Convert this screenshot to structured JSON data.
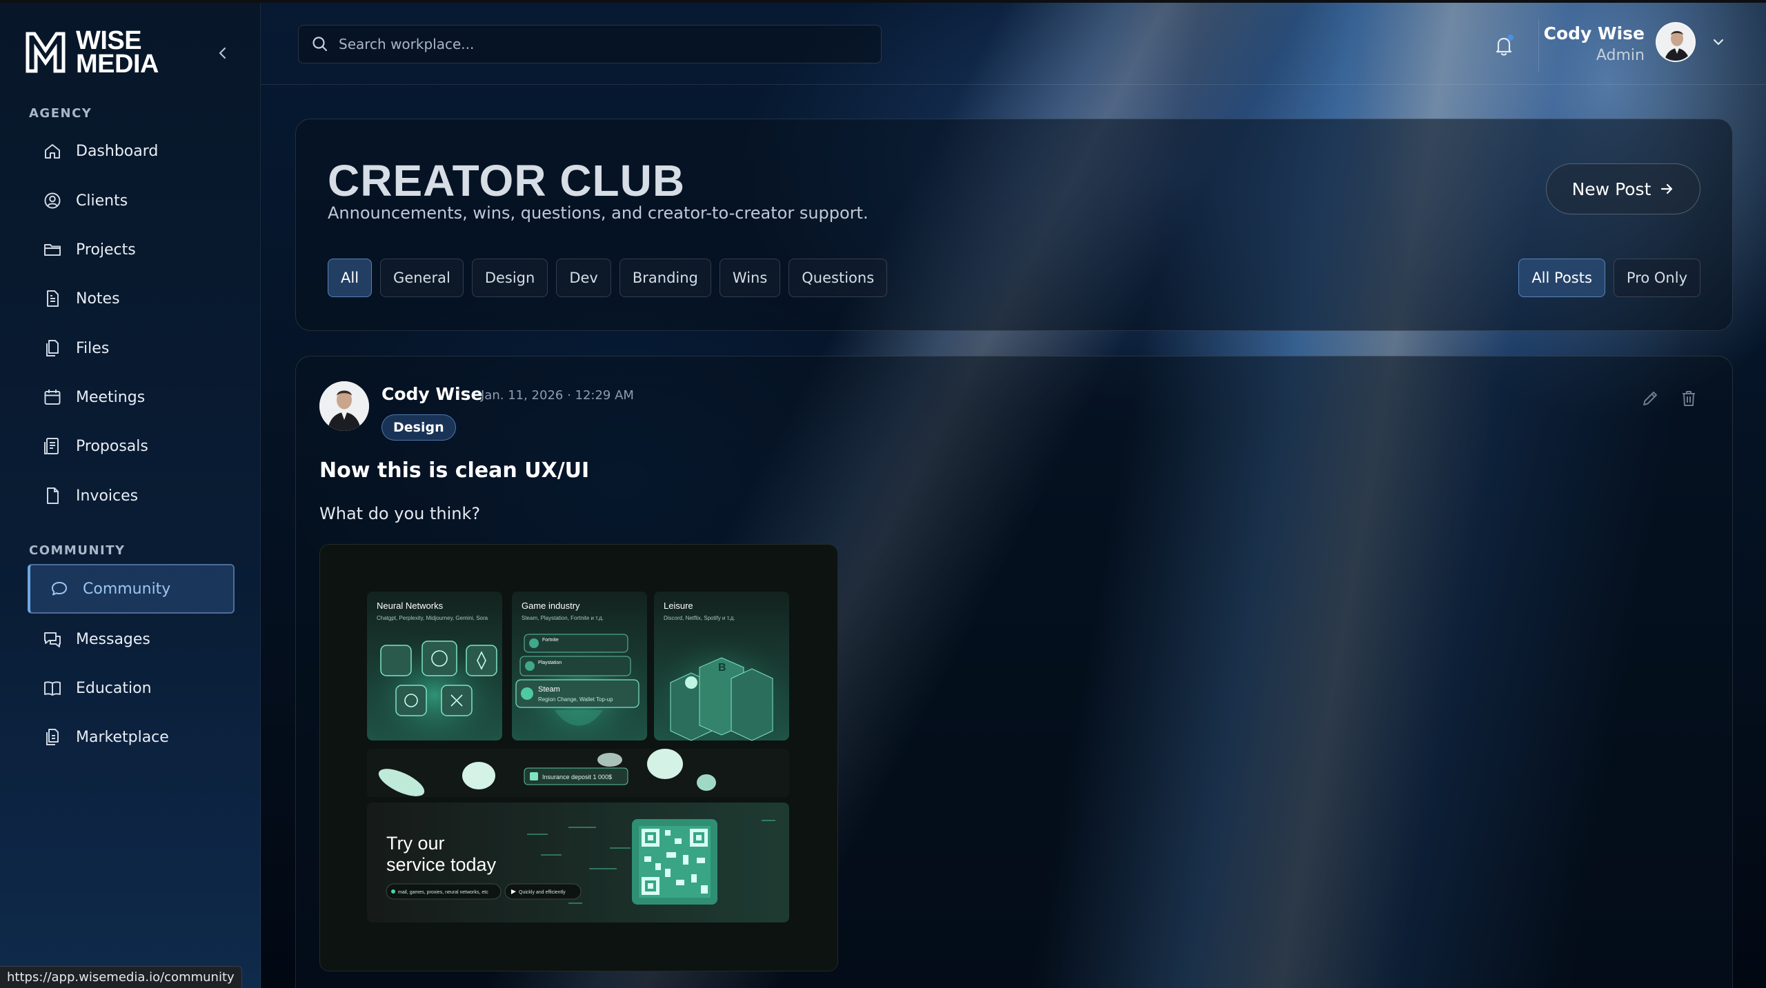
{
  "brand": {
    "line1": "WISE",
    "line2": "MEDIA"
  },
  "sidebar": {
    "sections": [
      {
        "label": "AGENCY"
      },
      {
        "label": "COMMUNITY"
      }
    ],
    "items": [
      {
        "label": "Dashboard",
        "icon": "home-icon"
      },
      {
        "label": "Clients",
        "icon": "user-circle-icon"
      },
      {
        "label": "Projects",
        "icon": "folder-icon"
      },
      {
        "label": "Notes",
        "icon": "note-icon"
      },
      {
        "label": "Files",
        "icon": "files-icon"
      },
      {
        "label": "Meetings",
        "icon": "calendar-icon"
      },
      {
        "label": "Proposals",
        "icon": "proposal-icon"
      },
      {
        "label": "Invoices",
        "icon": "invoice-icon"
      },
      {
        "label": "Community",
        "icon": "chat-bubble-icon",
        "active": true
      },
      {
        "label": "Messages",
        "icon": "messages-icon"
      },
      {
        "label": "Education",
        "icon": "book-icon"
      },
      {
        "label": "Marketplace",
        "icon": "marketplace-icon"
      }
    ]
  },
  "search": {
    "placeholder": "Search workplace..."
  },
  "user": {
    "name": "Cody Wise",
    "role": "Admin"
  },
  "header": {
    "title": "CREATOR CLUB",
    "subtitle": "Announcements, wins, questions, and creator-to-creator support.",
    "new_post_label": "New Post",
    "categories": [
      "All",
      "General",
      "Design",
      "Dev",
      "Branding",
      "Wins",
      "Questions"
    ],
    "active_category": "All",
    "filters": [
      "All Posts",
      "Pro Only"
    ],
    "active_filter": "All Posts"
  },
  "post": {
    "author": "Cody Wise",
    "timestamp": "Jan. 11, 2026 · 12:29 AM",
    "tag": "Design",
    "title": "Now this is clean UX/UI",
    "body": "What do you think?",
    "image": {
      "cards": [
        {
          "title": "Neural Networks",
          "subtitle": "Chatgpt, Perplexity, Midjourney, Gemini, Sora"
        },
        {
          "title": "Game industry",
          "subtitle": "Steam, Playstation, Fortnite и т.д."
        },
        {
          "title": "Leisure",
          "subtitle": "Discord, Netflix, Spotify и т.д."
        }
      ],
      "game_rows": [
        "Fortnite",
        "Playstation",
        "Steam"
      ],
      "steam_sub": "Region Change, Wallet Top-up",
      "deposit_label": "Insurance deposit 1 000$",
      "cta_line1": "Try our",
      "cta_line2": "service today",
      "pill1": "mail, games, proxies, neural networks, etc",
      "pill2": "Quickly and efficiently"
    }
  },
  "status_url": "https://app.wisemedia.io/community",
  "colors": {
    "accent": "#6ea8e6",
    "card_bg": "#06101e",
    "mint": "#3fd3a6"
  }
}
